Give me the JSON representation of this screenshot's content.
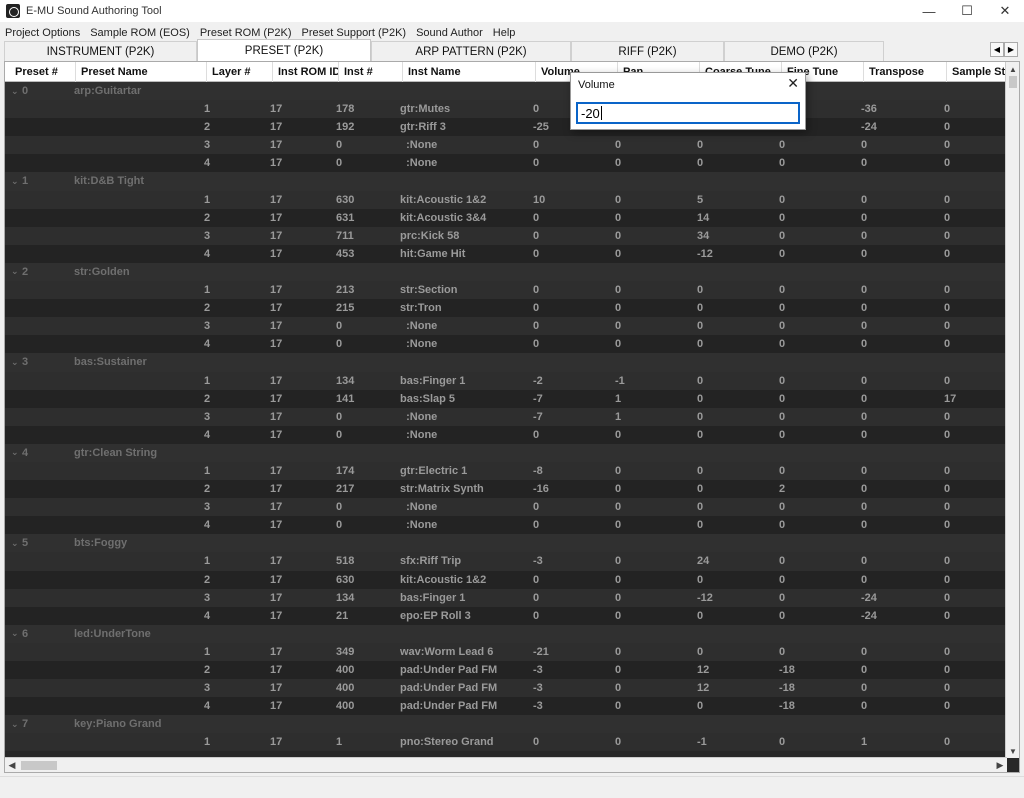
{
  "window": {
    "title": "E-MU Sound Authoring Tool",
    "minimize": "—",
    "maximize": "☐",
    "close": "✕"
  },
  "menu": [
    "Project Options",
    "Sample ROM (EOS)",
    "Preset ROM (P2K)",
    "Preset Support (P2K)",
    "Sound Author",
    "Help"
  ],
  "tabs": [
    "INSTRUMENT (P2K)",
    "PRESET (P2K)",
    "ARP PATTERN (P2K)",
    "RIFF (P2K)",
    "DEMO (P2K)"
  ],
  "active_tab": "PRESET (P2K)",
  "columns": [
    "Preset #",
    "Preset Name",
    "Layer #",
    "Inst ROM ID",
    "Inst #",
    "Inst Name",
    "Volume",
    "Pan",
    "Coarse Tune",
    "Fine Tune",
    "Transpose",
    "Sample Start"
  ],
  "presets": [
    {
      "num": "0",
      "name": "arp:Guitartar",
      "layers": [
        [
          "1",
          "17",
          "178",
          "gtr:Mutes",
          "0",
          "",
          "",
          "",
          "-36",
          "0"
        ],
        [
          "2",
          "17",
          "192",
          "gtr:Riff 3",
          "-25",
          "0",
          "24",
          "0",
          "-24",
          "0"
        ],
        [
          "3",
          "17",
          "0",
          "  :None",
          "0",
          "0",
          "0",
          "0",
          "0",
          "0"
        ],
        [
          "4",
          "17",
          "0",
          "  :None",
          "0",
          "0",
          "0",
          "0",
          "0",
          "0"
        ]
      ]
    },
    {
      "num": "1",
      "name": "kit:D&B Tight",
      "layers": [
        [
          "1",
          "17",
          "630",
          "kit:Acoustic 1&2",
          "10",
          "0",
          "5",
          "0",
          "0",
          "0"
        ],
        [
          "2",
          "17",
          "631",
          "kit:Acoustic 3&4",
          "0",
          "0",
          "14",
          "0",
          "0",
          "0"
        ],
        [
          "3",
          "17",
          "711",
          "prc:Kick 58",
          "0",
          "0",
          "34",
          "0",
          "0",
          "0"
        ],
        [
          "4",
          "17",
          "453",
          "hit:Game Hit",
          "0",
          "0",
          "-12",
          "0",
          "0",
          "0"
        ]
      ]
    },
    {
      "num": "2",
      "name": "str:Golden",
      "layers": [
        [
          "1",
          "17",
          "213",
          "str:Section",
          "0",
          "0",
          "0",
          "0",
          "0",
          "0"
        ],
        [
          "2",
          "17",
          "215",
          "str:Tron",
          "0",
          "0",
          "0",
          "0",
          "0",
          "0"
        ],
        [
          "3",
          "17",
          "0",
          "  :None",
          "0",
          "0",
          "0",
          "0",
          "0",
          "0"
        ],
        [
          "4",
          "17",
          "0",
          "  :None",
          "0",
          "0",
          "0",
          "0",
          "0",
          "0"
        ]
      ]
    },
    {
      "num": "3",
      "name": "bas:Sustainer",
      "layers": [
        [
          "1",
          "17",
          "134",
          "bas:Finger 1",
          "-2",
          "-1",
          "0",
          "0",
          "0",
          "0"
        ],
        [
          "2",
          "17",
          "141",
          "bas:Slap 5",
          "-7",
          "1",
          "0",
          "0",
          "0",
          "17"
        ],
        [
          "3",
          "17",
          "0",
          "  :None",
          "-7",
          "1",
          "0",
          "0",
          "0",
          "0"
        ],
        [
          "4",
          "17",
          "0",
          "  :None",
          "0",
          "0",
          "0",
          "0",
          "0",
          "0"
        ]
      ]
    },
    {
      "num": "4",
      "name": "gtr:Clean String",
      "layers": [
        [
          "1",
          "17",
          "174",
          "gtr:Electric 1",
          "-8",
          "0",
          "0",
          "0",
          "0",
          "0"
        ],
        [
          "2",
          "17",
          "217",
          "str:Matrix Synth",
          "-16",
          "0",
          "0",
          "2",
          "0",
          "0"
        ],
        [
          "3",
          "17",
          "0",
          "  :None",
          "0",
          "0",
          "0",
          "0",
          "0",
          "0"
        ],
        [
          "4",
          "17",
          "0",
          "  :None",
          "0",
          "0",
          "0",
          "0",
          "0",
          "0"
        ]
      ]
    },
    {
      "num": "5",
      "name": "bts:Foggy",
      "layers": [
        [
          "1",
          "17",
          "518",
          "sfx:Riff Trip",
          "-3",
          "0",
          "24",
          "0",
          "0",
          "0"
        ],
        [
          "2",
          "17",
          "630",
          "kit:Acoustic 1&2",
          "0",
          "0",
          "0",
          "0",
          "0",
          "0"
        ],
        [
          "3",
          "17",
          "134",
          "bas:Finger 1",
          "0",
          "0",
          "-12",
          "0",
          "-24",
          "0"
        ],
        [
          "4",
          "17",
          "21",
          "epo:EP Roll 3",
          "0",
          "0",
          "0",
          "0",
          "-24",
          "0"
        ]
      ]
    },
    {
      "num": "6",
      "name": "led:UnderTone",
      "layers": [
        [
          "1",
          "17",
          "349",
          "wav:Worm Lead 6",
          "-21",
          "0",
          "0",
          "0",
          "0",
          "0"
        ],
        [
          "2",
          "17",
          "400",
          "pad:Under Pad FM",
          "-3",
          "0",
          "12",
          "-18",
          "0",
          "0"
        ],
        [
          "3",
          "17",
          "400",
          "pad:Under Pad FM",
          "-3",
          "0",
          "12",
          "-18",
          "0",
          "0"
        ],
        [
          "4",
          "17",
          "400",
          "pad:Under Pad FM",
          "-3",
          "0",
          "0",
          "-18",
          "0",
          "0"
        ]
      ]
    },
    {
      "num": "7",
      "name": "key:Piano Grand",
      "layers": [
        [
          "1",
          "17",
          "1",
          "pno:Stereo Grand",
          "0",
          "0",
          "-1",
          "0",
          "1",
          "0"
        ]
      ]
    }
  ],
  "dialog": {
    "title": "Volume",
    "close": "✕",
    "value": "-20"
  }
}
